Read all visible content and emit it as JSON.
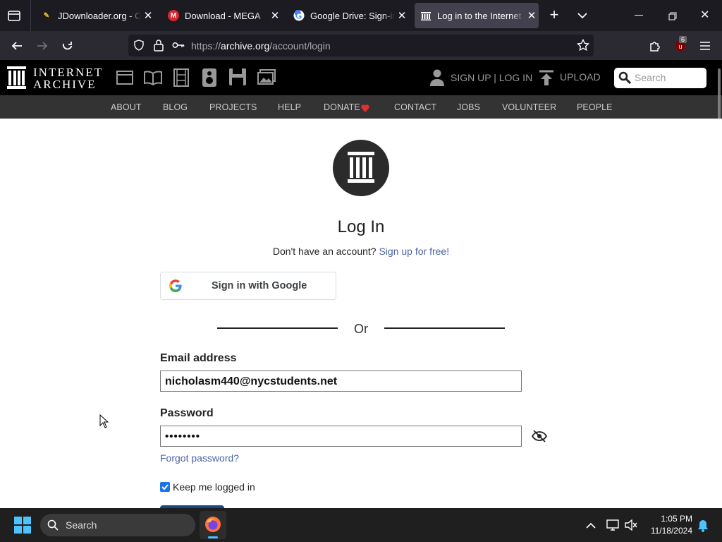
{
  "browser": {
    "tabs": [
      {
        "title": "JDownloader.org - Offi",
        "favicon": "jdownloader-icon"
      },
      {
        "title": "Download - MEGA",
        "favicon": "mega-icon"
      },
      {
        "title": "Google Drive: Sign-in",
        "favicon": "google-icon"
      },
      {
        "title": "Log in to the Internet A",
        "favicon": "archive-icon"
      }
    ],
    "url_prefix": "https://",
    "url_domain": "archive.org",
    "url_path": "/account/login",
    "extension_badge": "6"
  },
  "ia_header": {
    "logo_line1": "INTERNET",
    "logo_line2": "ARCHIVE",
    "signup_login": "SIGN UP | LOG IN",
    "upload": "UPLOAD",
    "search_placeholder": "Search",
    "nav": [
      "ABOUT",
      "BLOG",
      "PROJECTS",
      "HELP",
      "DONATE",
      "CONTACT",
      "JOBS",
      "VOLUNTEER",
      "PEOPLE"
    ]
  },
  "login": {
    "title": "Log In",
    "no_account": "Don't have an account?",
    "signup_link": "Sign up for free!",
    "google_button": "Sign in with Google",
    "or": "Or",
    "email_label": "Email address",
    "email_value": "nicholasm440@nycstudents.net",
    "password_label": "Password",
    "password_value": "••••••••",
    "forgot": "Forgot password?",
    "keep_logged": "Keep me logged in",
    "keep_checked": true
  },
  "taskbar": {
    "search": "Search",
    "time": "1:05 PM",
    "date": "11/18/2024"
  },
  "colors": {
    "link": "#4b64a7",
    "checkbox": "#1a73e8",
    "donate_heart": "#e03030"
  }
}
